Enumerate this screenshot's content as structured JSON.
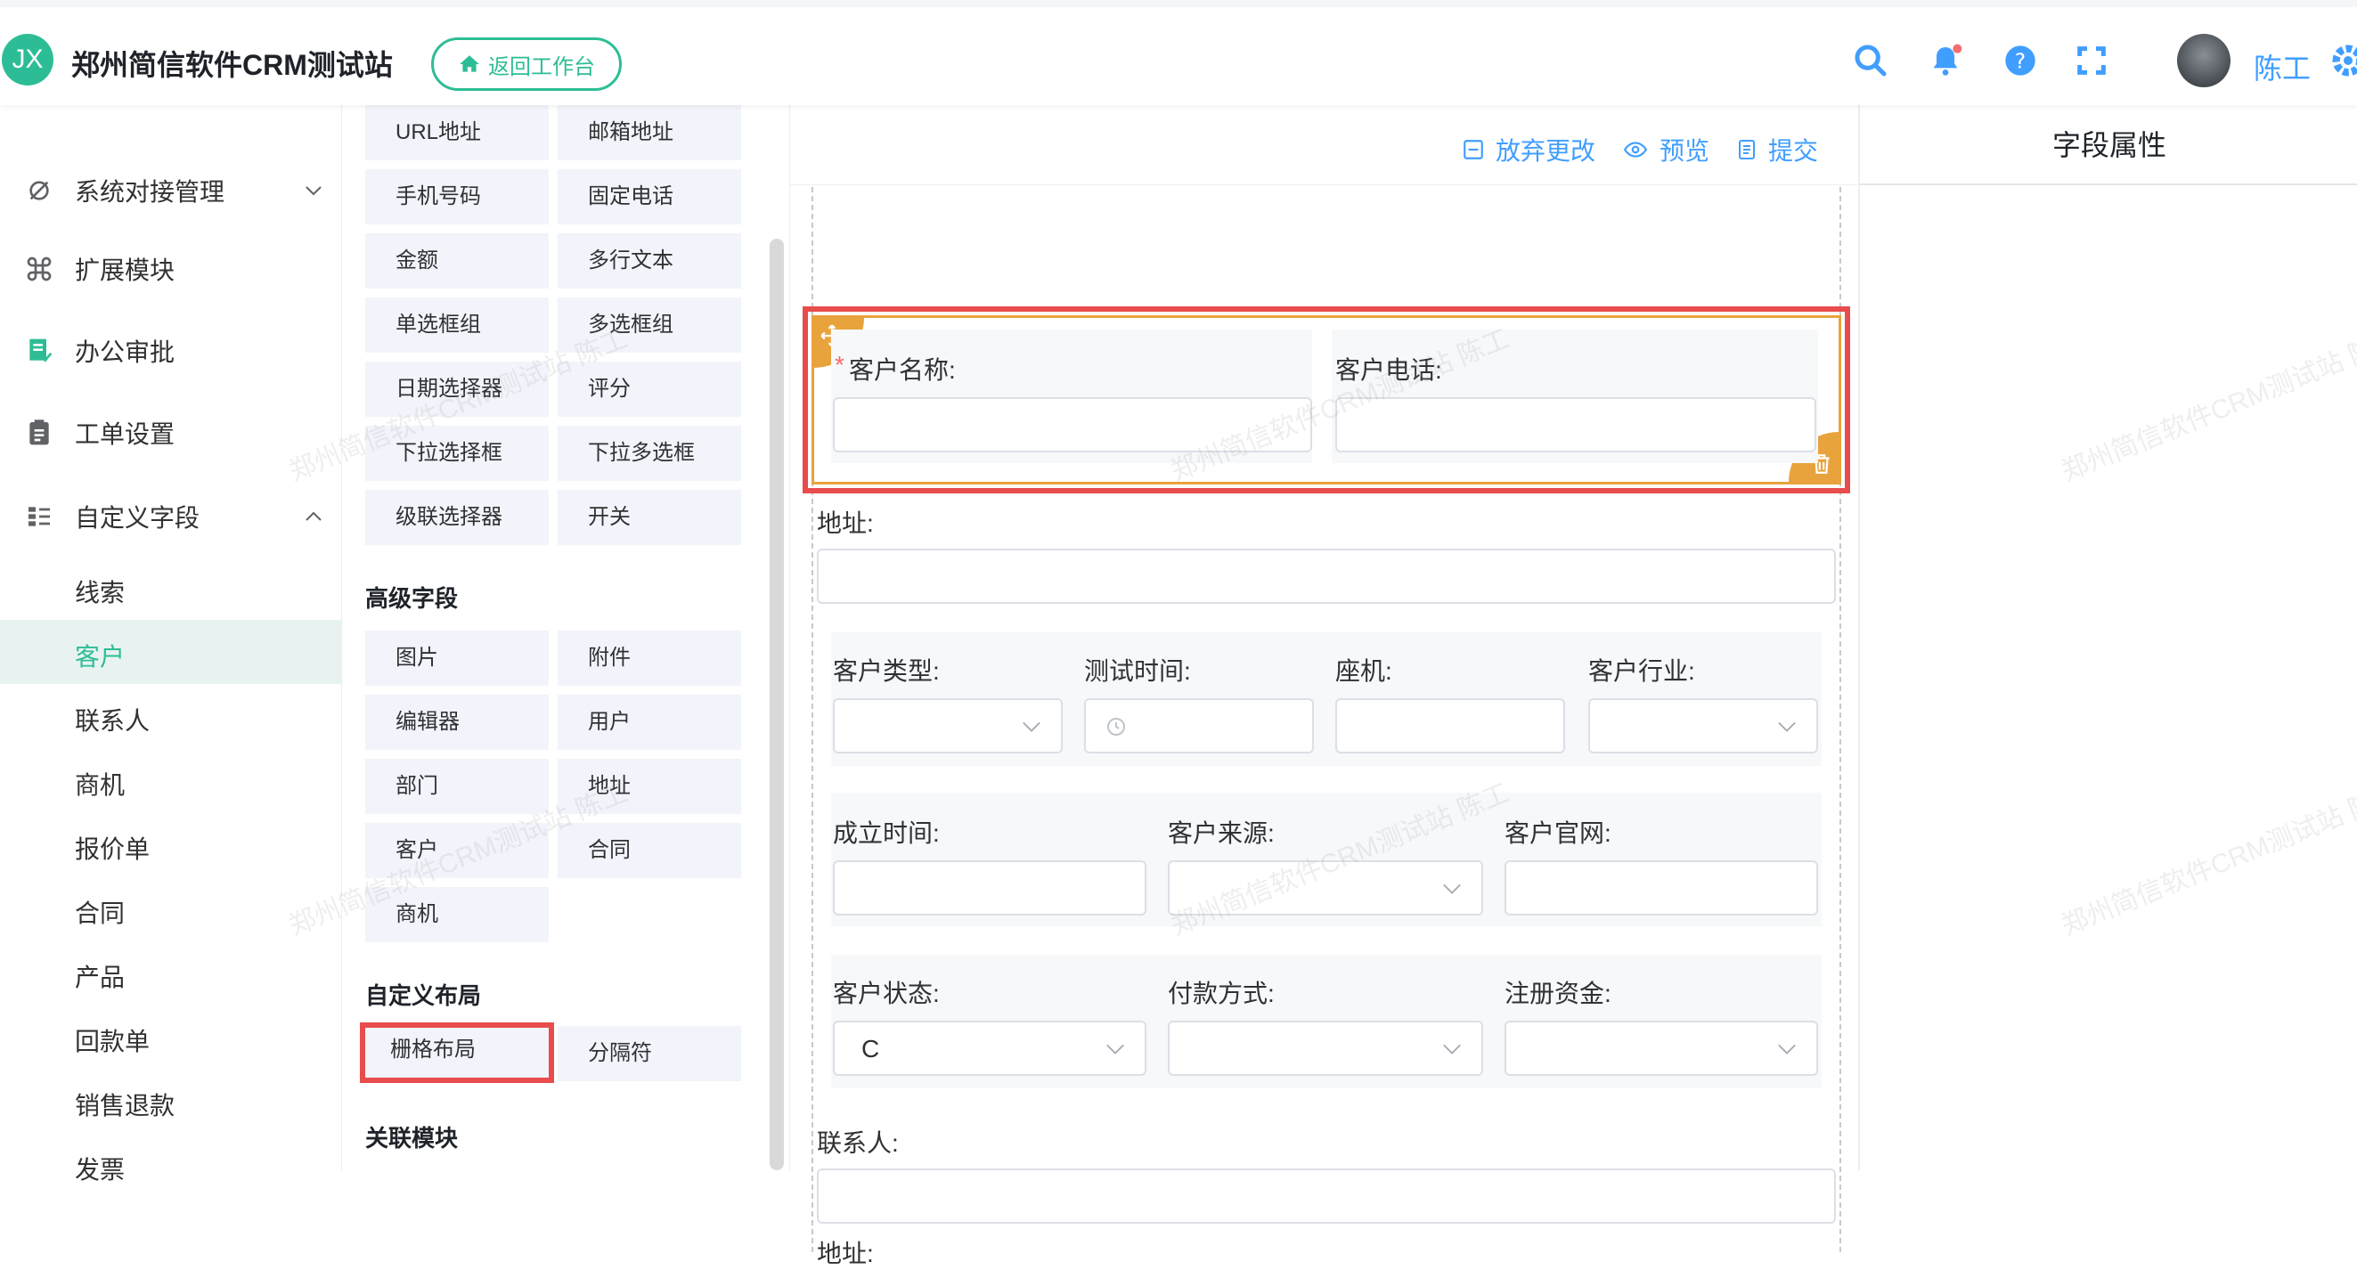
{
  "header": {
    "logo_text": "JX",
    "app_title": "郑州简信软件CRM测试站",
    "back_button": "返回工作台",
    "user_name": "陈工"
  },
  "sidebar": {
    "items": [
      {
        "label": "系统对接管理",
        "icon": "link-gear-icon",
        "expanded": false
      },
      {
        "label": "扩展模块",
        "icon": "command-icon"
      },
      {
        "label": "办公审批",
        "icon": "approval-doc-icon"
      },
      {
        "label": "工单设置",
        "icon": "clipboard-icon"
      },
      {
        "label": "自定义字段",
        "icon": "grid-list-icon",
        "expanded": true
      }
    ],
    "sub_items": [
      "线索",
      "客户",
      "联系人",
      "商机",
      "报价单",
      "合同",
      "产品",
      "回款单",
      "销售退款",
      "发票"
    ],
    "active_sub": "客户"
  },
  "palette": {
    "basic": [
      "URL地址",
      "邮箱地址",
      "手机号码",
      "固定电话",
      "金额",
      "多行文本",
      "单选框组",
      "多选框组",
      "日期选择器",
      "评分",
      "下拉选择框",
      "下拉多选框",
      "级联选择器",
      "开关"
    ],
    "advanced_title": "高级字段",
    "advanced": [
      "图片",
      "附件",
      "编辑器",
      "用户",
      "部门",
      "地址",
      "客户",
      "合同",
      "商机"
    ],
    "layout_title": "自定义布局",
    "layout": [
      "栅格布局",
      "分隔符"
    ],
    "related_title": "关联模块"
  },
  "toolbar": {
    "discard": "放弃更改",
    "preview": "预览",
    "submit": "提交"
  },
  "form": {
    "row1": [
      {
        "label": "客户名称:",
        "required": true
      },
      {
        "label": "客户电话:"
      }
    ],
    "address_label": "地址:",
    "row2": [
      {
        "label": "客户类型:",
        "type": "select"
      },
      {
        "label": "测试时间:",
        "type": "date"
      },
      {
        "label": "座机:"
      },
      {
        "label": "客户行业:",
        "type": "select"
      }
    ],
    "row3": [
      {
        "label": "成立时间:"
      },
      {
        "label": "客户来源:",
        "type": "select"
      },
      {
        "label": "客户官网:"
      }
    ],
    "row4": [
      {
        "label": "客户状态:",
        "type": "select",
        "value": "C"
      },
      {
        "label": "付款方式:",
        "type": "select"
      },
      {
        "label": "注册资金:",
        "type": "select"
      }
    ],
    "contact_label": "联系人:",
    "address2_label": "地址:"
  },
  "properties": {
    "title": "字段属性"
  },
  "watermark": "郑州简信软件CRM测试站 陈工",
  "colors": {
    "brand": "#2dbd96",
    "link": "#409eff",
    "highlight": "#e84c4c",
    "selected": "#e8a33c"
  }
}
